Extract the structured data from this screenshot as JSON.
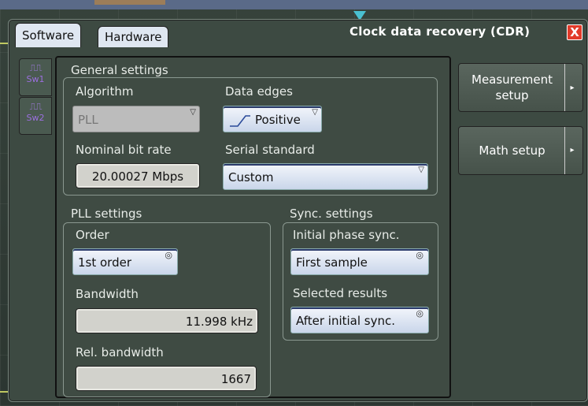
{
  "window": {
    "title": "Clock data recovery (CDR)",
    "close_glyph": "X",
    "tabs": [
      {
        "label": "Software",
        "active": true
      },
      {
        "label": "Hardware",
        "active": false
      }
    ]
  },
  "side_tabs": [
    {
      "label": "Sw1",
      "icon": "square-wave-icon",
      "active": true
    },
    {
      "label": "Sw2",
      "icon": "square-wave-icon",
      "active": false
    }
  ],
  "general_settings": {
    "title": "General settings",
    "algorithm": {
      "label": "Algorithm",
      "value": "PLL",
      "enabled": false
    },
    "data_edges": {
      "label": "Data edges",
      "value": "Positive",
      "icon": "rising-edge-icon"
    },
    "nominal_bit_rate": {
      "label": "Nominal bit rate",
      "value": "20.00027 Mbps"
    },
    "serial_standard": {
      "label": "Serial standard",
      "value": "Custom"
    }
  },
  "pll_settings": {
    "title": "PLL settings",
    "order": {
      "label": "Order",
      "value": "1st order"
    },
    "bandwidth": {
      "label": "Bandwidth",
      "value": "11.998 kHz"
    },
    "rel_bandwidth": {
      "label": "Rel. bandwidth",
      "value": "1667"
    }
  },
  "sync_settings": {
    "title": "Sync. settings",
    "initial_phase_sync": {
      "label": "Initial phase sync.",
      "value": "First sample"
    },
    "selected_results": {
      "label": "Selected results",
      "value": "After initial sync."
    }
  },
  "side_buttons": [
    {
      "label": "Measurement setup",
      "label_line1": "Measurement",
      "label_line2": "setup"
    },
    {
      "label": "Math setup"
    }
  ],
  "colors": {
    "accent_blue": "#c9d6ea",
    "close_red": "#e23b2a",
    "trace_yellow": "#d8e06a",
    "marker_cyan": "#4ac0d0"
  }
}
